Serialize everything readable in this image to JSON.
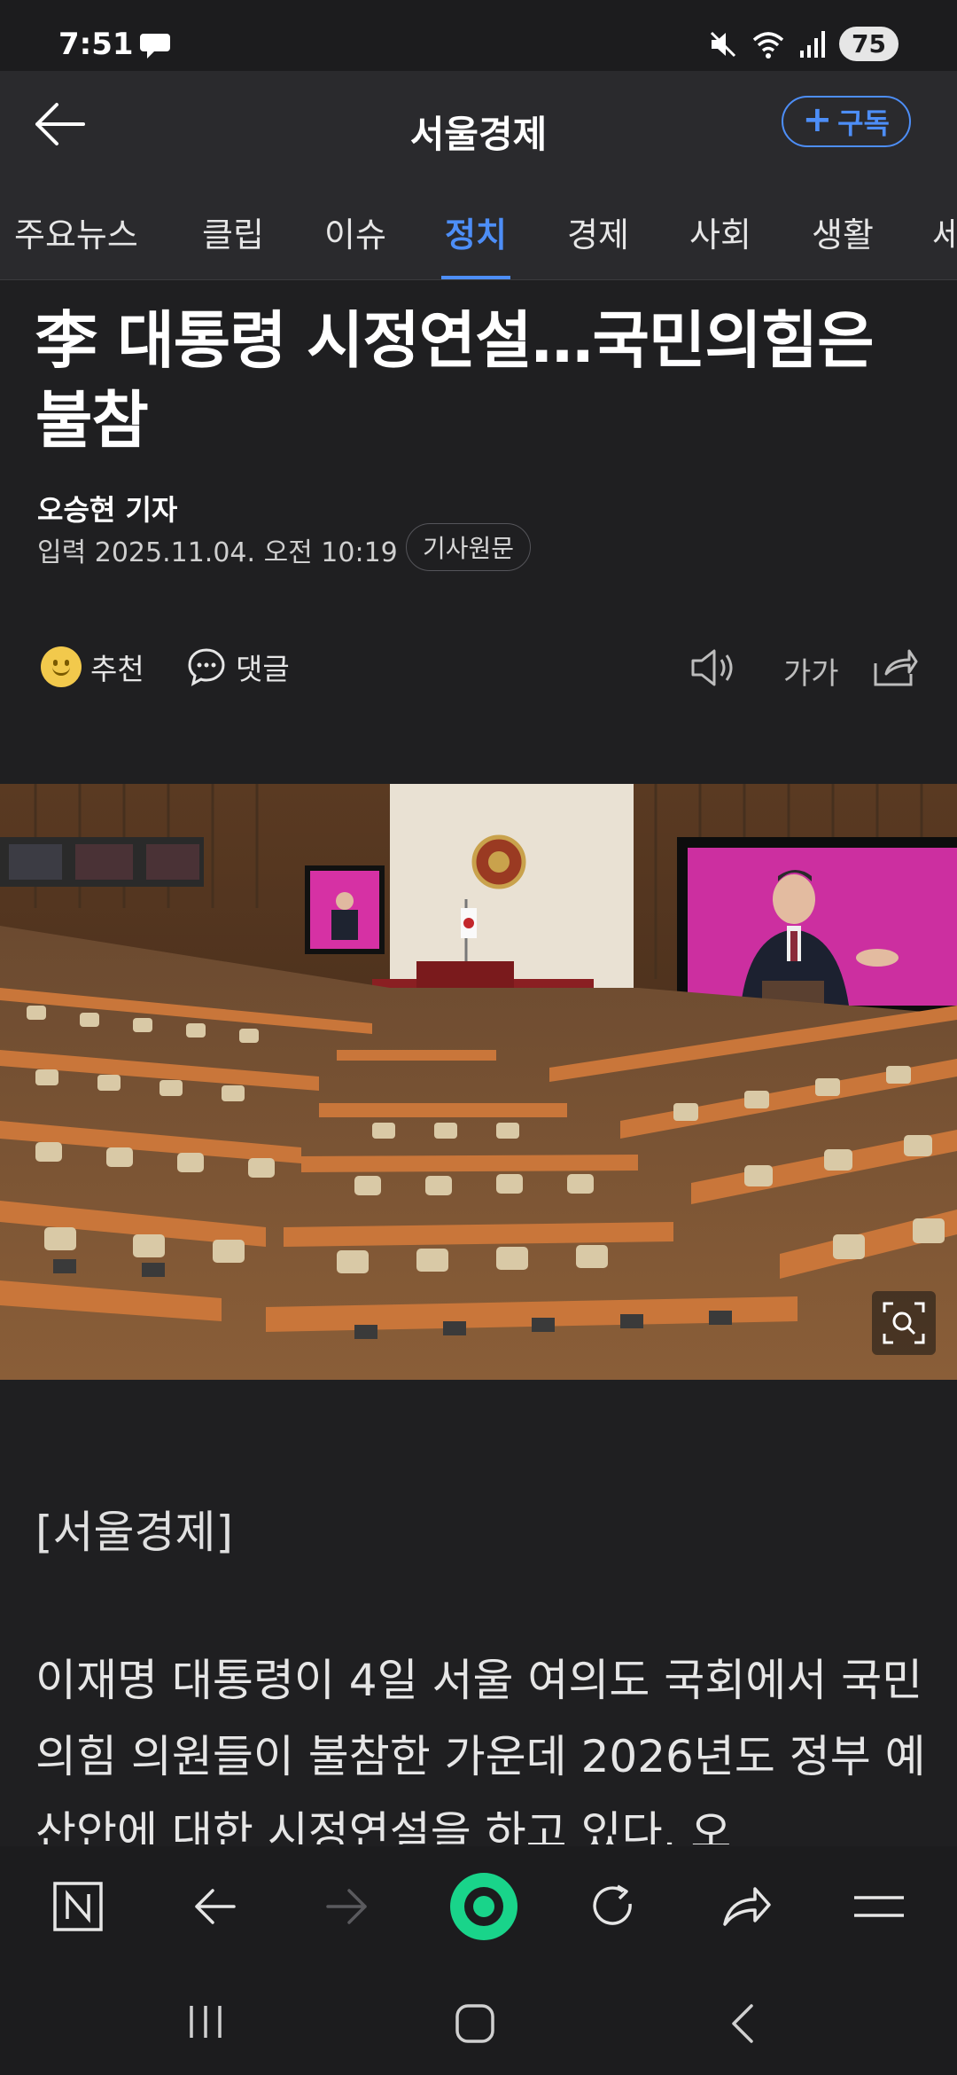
{
  "status_bar": {
    "time": "7:51",
    "battery": "75"
  },
  "header": {
    "title": "서울경제",
    "subscribe_label": "구독"
  },
  "tabs": [
    {
      "label": "주요뉴스"
    },
    {
      "label": "클립"
    },
    {
      "label": "이슈"
    },
    {
      "label": "정치",
      "active": true
    },
    {
      "label": "경제"
    },
    {
      "label": "사회"
    },
    {
      "label": "생활"
    },
    {
      "label": "세"
    }
  ],
  "article": {
    "headline": "李 대통령 시정연설…국민의힘은 불참",
    "reporter": "오승현 기자",
    "dateline": "입력 2025.11.04. 오전 10:19",
    "original_label": "기사원문",
    "source": "[서울경제]",
    "body": "이재명 대통령이 4일 서울 여의도 국회에서 국민의힘 의원들이 불참한 가운데 2026년도 정부 예산안에 대한 시정연설을 하고 있다. 오"
  },
  "actions": {
    "recommend_label": "추천",
    "comment_label": "댓글",
    "font_size_label": "가가"
  },
  "colors": {
    "accent": "#4d8ef7",
    "background": "#1f1f21",
    "header_bg": "#2a2a2d",
    "browser_green": "#19d48a"
  }
}
